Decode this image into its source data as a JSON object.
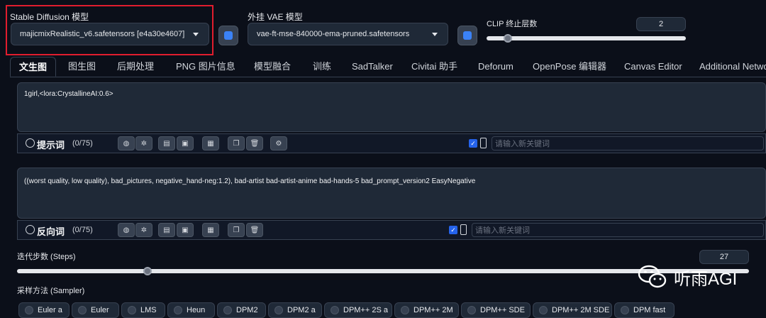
{
  "top": {
    "model_label": "Stable Diffusion 模型",
    "model_value": "majicmixRealistic_v6.safetensors [e4a30e4607]",
    "vae_label": "外挂 VAE 模型",
    "vae_value": "vae-ft-mse-840000-ema-pruned.safetensors",
    "clip_label": "CLIP 终止层数",
    "clip_value": "2"
  },
  "tabs": [
    "文生图",
    "图生图",
    "后期处理",
    "PNG 图片信息",
    "模型融合",
    "训练",
    "SadTalker",
    "Civitai 助手",
    "Deforum",
    "OpenPose 编辑器",
    "Canvas Editor",
    "Additional Netwo"
  ],
  "prompt": {
    "text": "1girl,<lora:CrystallineAI:0.6>",
    "title": "提示词",
    "count": "(0/75)",
    "keyword_placeholder": "请输入新关键词"
  },
  "negative": {
    "text": "((worst quality, low quality), bad_pictures, negative_hand-neg:1.2), bad-artist bad-artist-anime bad-hands-5 bad_prompt_version2 EasyNegative",
    "title": "反向词",
    "count": "(0/75)",
    "keyword_placeholder": "请输入新关键词"
  },
  "steps": {
    "label": "迭代步数 (Steps)",
    "value": "27"
  },
  "sampler": {
    "label": "采样方法 (Sampler)",
    "options": [
      "Euler a",
      "Euler",
      "LMS",
      "Heun",
      "DPM2",
      "DPM2 a",
      "DPM++ 2S a",
      "DPM++ 2M",
      "DPM++ SDE",
      "DPM++ 2M SDE",
      "DPM fast"
    ]
  },
  "watermark": {
    "text": "听雨AGI"
  },
  "colors": {
    "accent": "#3b82f6",
    "highlight_box": "#e11d2e",
    "background": "#0b0f19"
  }
}
